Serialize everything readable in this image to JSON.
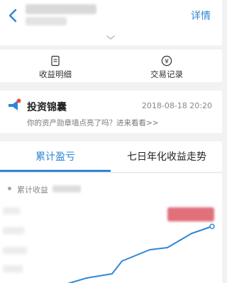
{
  "header": {
    "detail_label": "详情"
  },
  "quick_actions": [
    {
      "label": "收益明细",
      "icon": "document-icon"
    },
    {
      "label": "交易记录",
      "icon": "yen-circle-icon"
    }
  ],
  "promo": {
    "title": "投资锦囊",
    "time": "2018-08-18 20:20",
    "desc": "你的资产勋章墙点亮了吗？进来看看>>"
  },
  "tabs": [
    {
      "label": "累计盈亏",
      "active": true
    },
    {
      "label": "七日年化收益走势",
      "active": false
    }
  ],
  "chart": {
    "legend_label": "累计收益",
    "line_color": "#2f86d6"
  },
  "colors": {
    "accent": "#2f86d6",
    "background": "#f2f2f2"
  }
}
